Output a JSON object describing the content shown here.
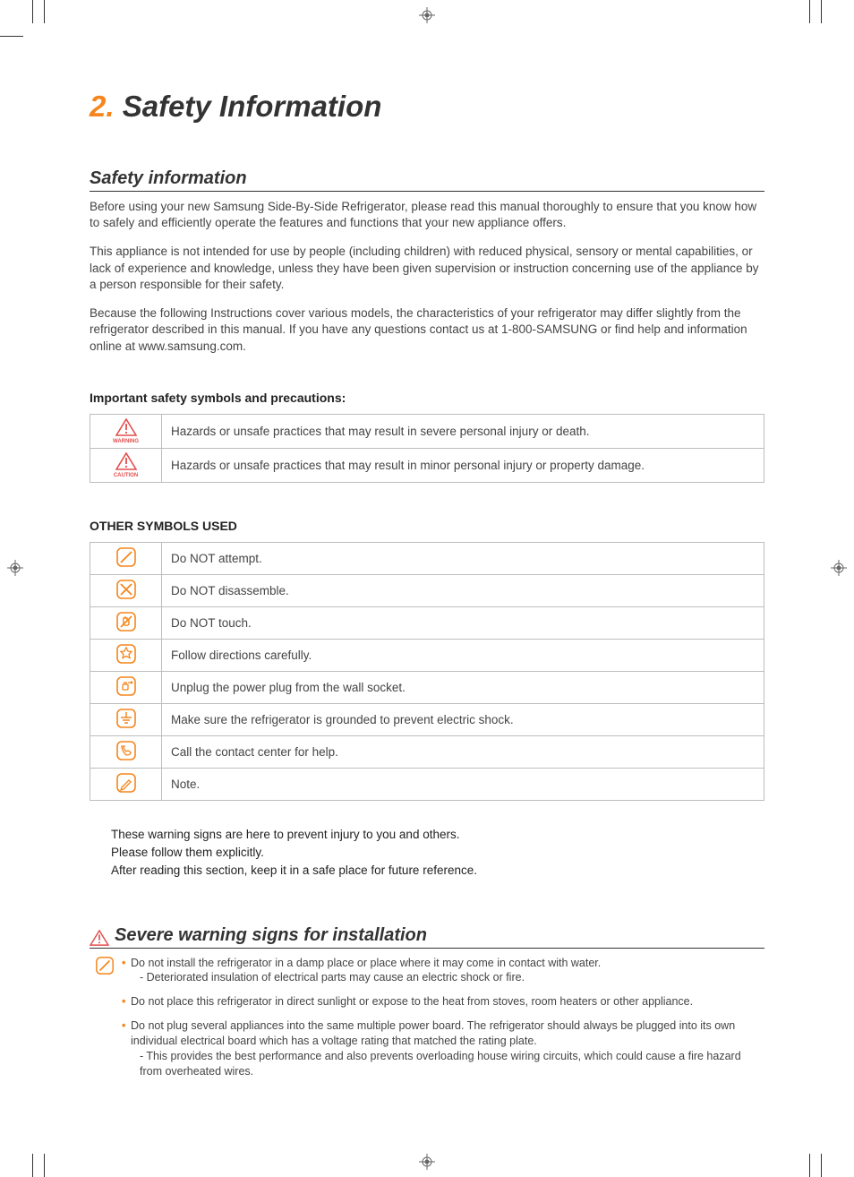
{
  "title_num": "2.",
  "title_text": "Safety Information",
  "section1_title": "Safety information",
  "intro_p1": "Before using your new Samsung Side-By-Side Refrigerator, please read this manual thoroughly to ensure that you know how to safely and efficiently operate the features and functions that your new appliance offers.",
  "intro_p2": "This appliance is not intended for use by people (including children) with reduced physical, sensory or mental capabilities, or lack of experience and knowledge, unless they have been given supervision or instruction concerning use of the appliance by a person responsible for their safety.",
  "intro_p3": "Because the following Instructions cover various models, the characteristics of your refrigerator may differ slightly from the refrigerator described in this manual. If you have any questions contact us at 1-800-SAMSUNG or find help and information online at www.samsung.com.",
  "symbols_heading": "Important safety symbols and precautions:",
  "warning_label": "WARNING",
  "caution_label": "CAUTION",
  "warning_desc": "Hazards or unsafe practices that may result in severe personal injury or death.",
  "caution_desc": "Hazards or unsafe practices that may result in minor personal injury or property damage.",
  "other_symbols_heading": "OTHER SYMBOLS USED",
  "symbols": [
    {
      "name": "no-attempt-icon",
      "desc": "Do NOT attempt."
    },
    {
      "name": "no-disassemble-icon",
      "desc": "Do NOT disassemble."
    },
    {
      "name": "no-touch-icon",
      "desc": "Do NOT touch."
    },
    {
      "name": "follow-directions-icon",
      "desc": "Follow directions carefully."
    },
    {
      "name": "unplug-icon",
      "desc": "Unplug the power plug from the wall socket."
    },
    {
      "name": "ground-icon",
      "desc": "Make sure the refrigerator is grounded to prevent electric shock."
    },
    {
      "name": "contact-center-icon",
      "desc": "Call the contact center for help."
    },
    {
      "name": "note-icon",
      "desc": "Note."
    }
  ],
  "note_l1": "These warning signs are here to prevent injury to you and others.",
  "note_l2": "Please follow them explicitly.",
  "note_l3": "After reading this section, keep it in a safe place for future reference.",
  "section2_title": "Severe warning signs for installation",
  "install_bullets": [
    {
      "text": "Do not install the refrigerator in a damp place or place where it may come in contact with water.",
      "sub": "- Deteriorated insulation of electrical parts may cause an electric shock or fire."
    },
    {
      "text": "Do not place this refrigerator in direct sunlight or expose to the heat from stoves, room heaters or other appliance.",
      "sub": null
    },
    {
      "text": "Do not plug several appliances into the same multiple power board. The refrigerator should always be plugged into its own individual electrical board which has a voltage rating that matched the rating plate.",
      "sub": "- This provides the best performance and also prevents overloading house wiring circuits, which could cause a fire hazard from overheated wires."
    }
  ]
}
